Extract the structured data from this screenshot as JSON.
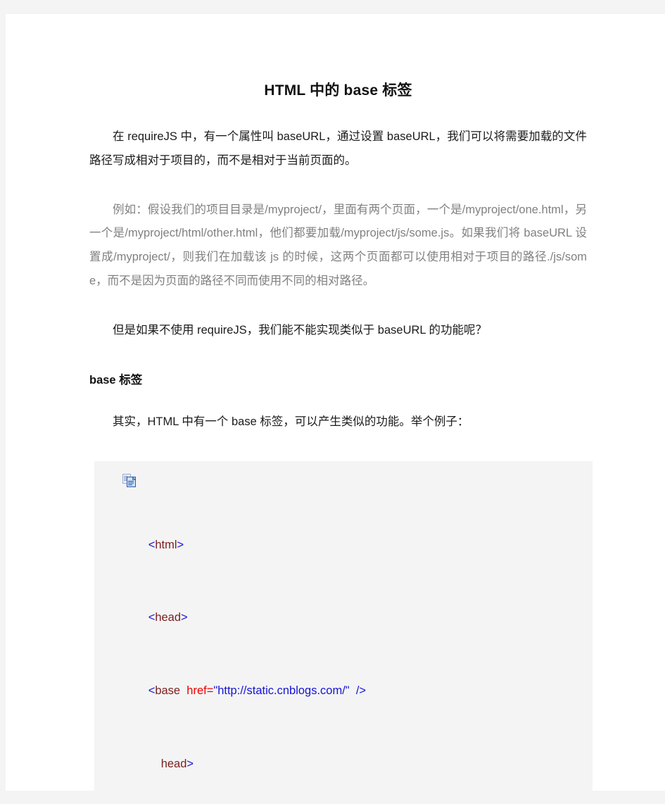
{
  "document": {
    "title": "HTML 中的 base 标签",
    "paragraphs": [
      {
        "id": "intro",
        "style": "dark",
        "text": "在 requireJS 中，有一个属性叫 baseURL，通过设置 baseURL，我们可以将需要加载的文件路径写成相对于项目的，而不是相对于当前页面的。"
      },
      {
        "id": "example",
        "style": "muted",
        "text": "例如：假设我们的项目目录是/myproject/，里面有两个页面，一个是/myproject/one.html，另一个是/myproject/html/other.html，他们都要加载/myproject/js/some.js。如果我们将 baseURL 设置成/myproject/，则我们在加载该 js 的时候，这两个页面都可以使用相对于项目的路径./js/some，而不是因为页面的路径不同而使用不同的相对路径。"
      },
      {
        "id": "question",
        "style": "dark",
        "text": "但是如果不使用 requireJS，我们能不能实现类似于 baseURL 的功能呢？"
      }
    ],
    "section_heading": "base 标签",
    "section_paragraph": "其实，HTML 中有一个 base 标签，可以产生类似的功能。举个例子：",
    "code_block": {
      "copy_icon_label": "copy-to-clipboard",
      "background_color": "#f4f4f4",
      "lines": [
        {
          "id": "line-html",
          "indent": false,
          "tokens": [
            {
              "type": "bracket",
              "text": "<"
            },
            {
              "type": "tag",
              "text": "html"
            },
            {
              "type": "bracket",
              "text": ">"
            }
          ]
        },
        {
          "id": "line-head",
          "indent": false,
          "tokens": [
            {
              "type": "bracket",
              "text": "<"
            },
            {
              "type": "tag",
              "text": "head"
            },
            {
              "type": "bracket",
              "text": ">"
            }
          ]
        },
        {
          "id": "line-base",
          "indent": false,
          "tokens": [
            {
              "type": "bracket",
              "text": "<"
            },
            {
              "type": "tag",
              "text": "base"
            },
            {
              "type": "plain",
              "text": "  "
            },
            {
              "type": "attr",
              "text": "href"
            },
            {
              "type": "eq",
              "text": "="
            },
            {
              "type": "string",
              "text": "\"http://static.cnblogs.com/\""
            },
            {
              "type": "plain",
              "text": "  "
            },
            {
              "type": "bracket",
              "text": "/>"
            }
          ]
        },
        {
          "id": "line-head-close",
          "indent": true,
          "tokens": [
            {
              "type": "tag",
              "text": "head"
            },
            {
              "type": "bracket",
              "text": ">"
            }
          ]
        }
      ]
    }
  },
  "colors": {
    "page_background": "#ffffff",
    "outer_background": "#f4f4f4",
    "title_text": "#111111",
    "body_text": "#1b1b1b",
    "muted_text": "#808080",
    "code_bracket": "#1414d6",
    "code_tag": "#7b1e1e",
    "code_attr": "#ee0000",
    "code_string": "#1414d6"
  }
}
